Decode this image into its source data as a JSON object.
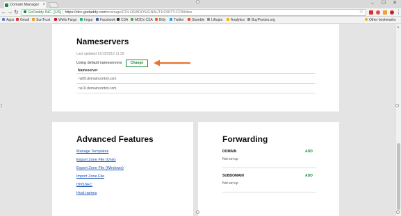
{
  "browser": {
    "tab_title": "Domain Manager",
    "tab_close": "×",
    "window_controls": [
      "–",
      "☐",
      "✕"
    ],
    "nav": {
      "back": "←",
      "forward": "→",
      "reload": "↻"
    },
    "omnibox": {
      "secure_label": "GoDaddy INC. [US]",
      "separator": "|",
      "url_host": "https://dcc.godaddy.com",
      "url_path": "/manage/COLORADOSIGNAUTHORITY.COM/dns"
    },
    "bookmarks": [
      {
        "label": "Apps",
        "color": "#5b7fd6"
      },
      {
        "label": "Gmail",
        "color": "#d93025"
      },
      {
        "label": "SunTrust",
        "color": "#f09a1c"
      },
      {
        "label": "Wells Fargo",
        "color": "#c8102e"
      },
      {
        "label": "Imgur",
        "color": "#1bb76e"
      },
      {
        "label": "Facebook",
        "color": "#3b5998"
      },
      {
        "label": "CSA",
        "color": "#333333"
      },
      {
        "label": "MODx CSA",
        "color": "#53a548"
      },
      {
        "label": "Bitly",
        "color": "#ee6123"
      },
      {
        "label": "Twitter",
        "color": "#1da1f2"
      },
      {
        "label": "Stumble",
        "color": "#eb4924"
      },
      {
        "label": "Liftopia",
        "color": "#8a8a8a"
      },
      {
        "label": "Analytics",
        "color": "#f4b400"
      },
      {
        "label": "BuyProxies.org",
        "color": "#8a8a8a"
      }
    ],
    "other_bookmarks": "Other bookmarks"
  },
  "nameservers": {
    "title": "Nameservers",
    "last_updated": "Last updated 11/13/2012 11:39",
    "status_text": "Using default nameservers",
    "change_label": "Change",
    "column_header": "Nameserver",
    "rows": [
      "ns09.domaincontrol.com",
      "ns10.domaincontrol.com"
    ]
  },
  "advanced": {
    "title": "Advanced Features",
    "links": [
      "Manage Templates",
      "Export Zone File (Unix)",
      "Export Zone File (Windows)",
      "Import Zone File",
      "DNSSEC",
      "Host names"
    ]
  },
  "forwarding": {
    "title": "Forwarding",
    "domain_label": "DOMAIN",
    "domain_add": "ADD",
    "domain_value": "Not set up",
    "subdomain_label": "SUBDOMAIN",
    "subdomain_add": "ADD",
    "subdomain_value": "Not set up"
  },
  "colors": {
    "accent_green": "#1a8a3a",
    "arrow_orange": "#e8742a",
    "link_blue": "#1a4fb5"
  }
}
